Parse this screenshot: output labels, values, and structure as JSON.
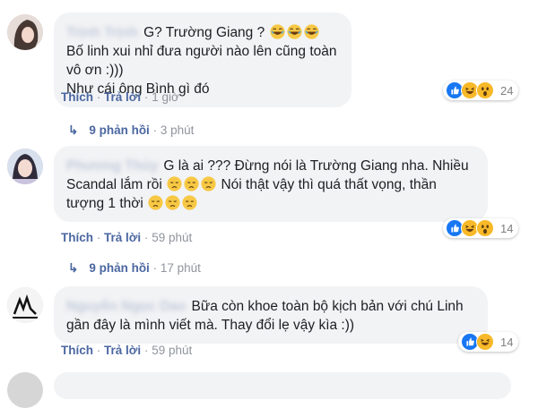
{
  "comments": [
    {
      "author": "Trịnh Trịnh",
      "text_parts": [
        "G? Trường Giang ?",
        "Bố linh xui nhỉ đưa người nào lên cũng toàn vô ơn :)))",
        "Như cái ông Bình gì đó"
      ],
      "emoji": "laughing-emoji",
      "like_label": "Thích",
      "reply_label": "Trả lời",
      "time": "1 giờ",
      "reaction_count": "24",
      "reply_link": "9 phản hồi",
      "reply_time": "3 phút"
    },
    {
      "author": "Phương Thủy",
      "text_parts": [
        "G là ai ??? Đừng nói là Trường Giang nha. Nhiều Scandal lắm rồi",
        "Nói thật vậy thì quá thất vọng, thần tượng 1 thời"
      ],
      "emoji": "disappointed-emoji",
      "like_label": "Thích",
      "reply_label": "Trả lời",
      "time": "59 phút",
      "reaction_count": "14",
      "reply_link": "9 phản hồi",
      "reply_time": "17 phút"
    },
    {
      "author": "Nguyễn Ngọc Dao",
      "text_parts": [
        "Bữa còn khoe toàn bộ kịch bản với chú Linh gần đây là mình viết mà. Thay đổi lẹ vậy kìa :))"
      ],
      "like_label": "Thích",
      "reply_label": "Trả lời",
      "time": "59 phút",
      "reaction_count": "14"
    }
  ],
  "separator": "·",
  "colors": {
    "link": "#4b67a1",
    "bubble": "#f2f3f5",
    "meta": "#90949c",
    "like": "#1877f2",
    "haha": "#f7b928"
  }
}
